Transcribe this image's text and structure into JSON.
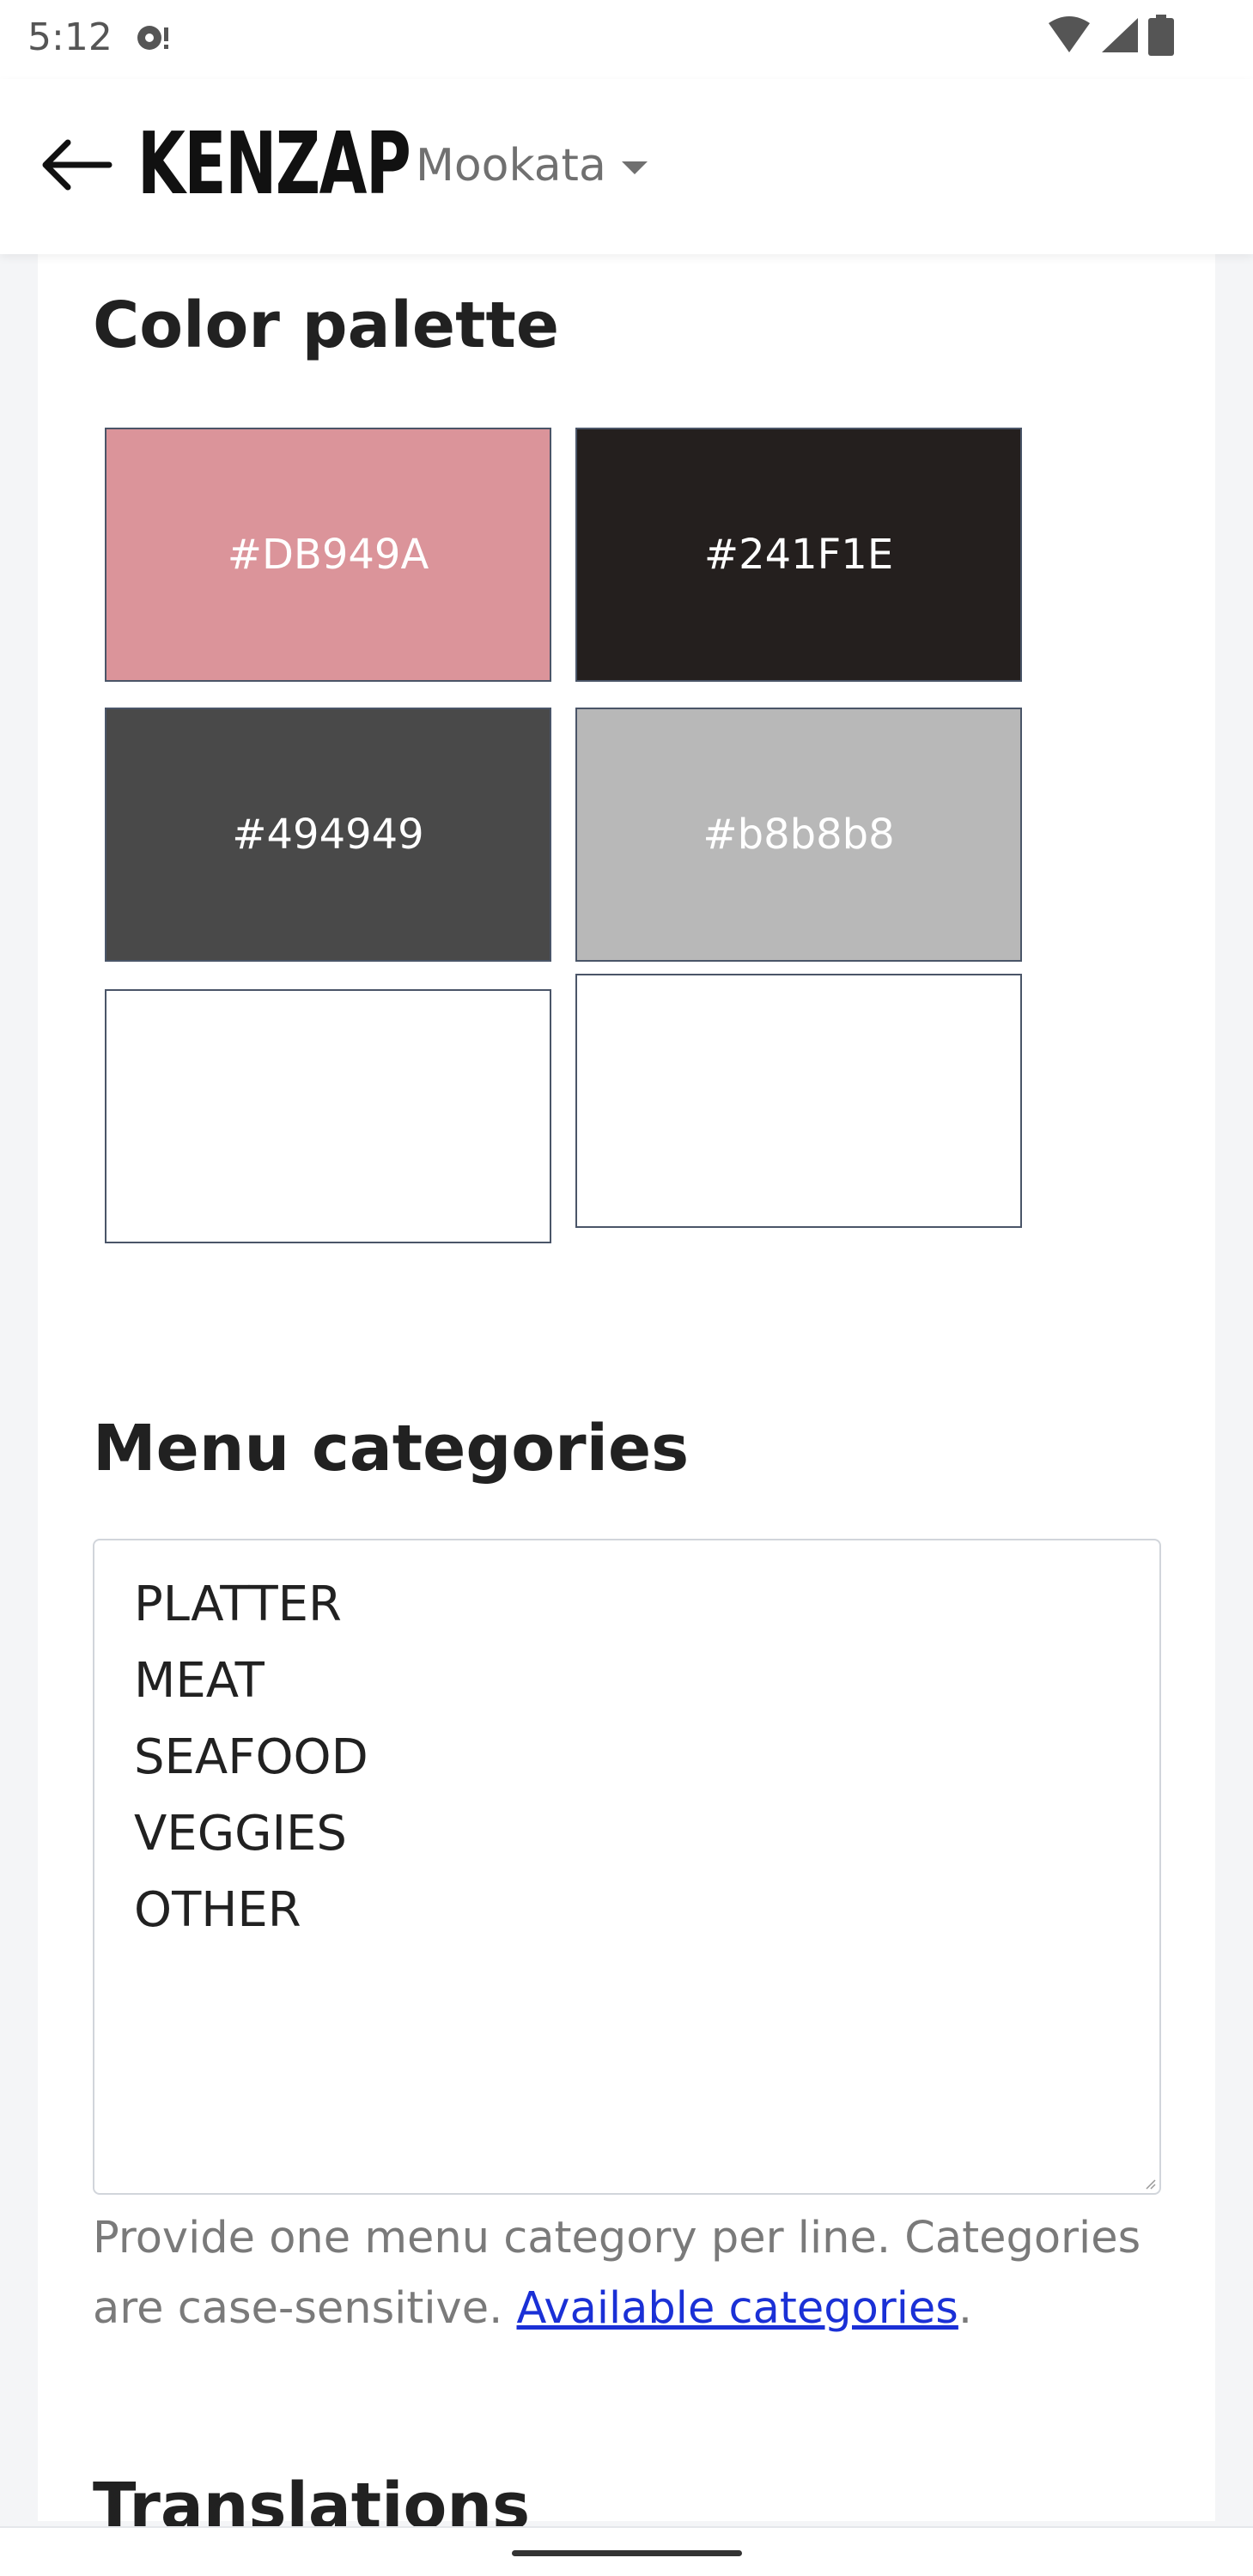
{
  "status_bar": {
    "time": "5:12"
  },
  "header": {
    "brand": "KENZAP",
    "store_name": "Mookata"
  },
  "color_palette": {
    "title": "Color palette",
    "swatches": [
      {
        "label": "#DB949A",
        "color": "#DB949A"
      },
      {
        "label": "#241F1E",
        "color": "#241F1E"
      },
      {
        "label": "#494949",
        "color": "#494949"
      },
      {
        "label": "#b8b8b8",
        "color": "#b8b8b8"
      },
      {
        "label": "",
        "color": "#FFFFFF"
      },
      {
        "label": "",
        "color": "#FFFFFF"
      }
    ]
  },
  "menu_categories": {
    "title": "Menu categories",
    "lines": [
      "PLATTER",
      "MEAT",
      "SEAFOOD",
      "VEGGIES",
      "OTHER"
    ],
    "help_text": "Provide one menu category per line. Categories are case-sensitive. ",
    "help_link": "Available categories",
    "help_suffix": "."
  },
  "translations": {
    "title": "Translations"
  },
  "colors": {
    "link": "#1a30d6",
    "border": "#4a5568",
    "background": "#f4f5f7"
  }
}
